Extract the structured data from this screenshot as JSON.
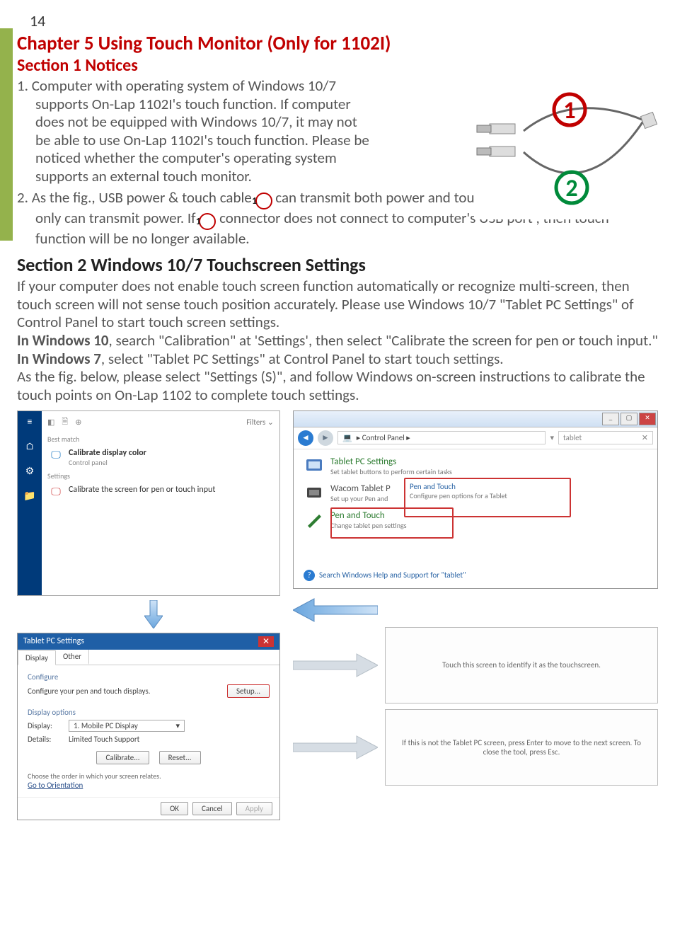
{
  "page_number": "14",
  "chapter_title": "Chapter 5  Using Touch Monitor (Only for 1102I)",
  "section1_title": "Section 1  Notices",
  "notice1_prefix": "1. Computer with operating system of Windows 10/7 supports On-Lap 1102I's touch function. If computer does not be equipped with Windows 10/7, it may not be able to use On-Lap 1102I's touch function. Please be noticed whether the computer's operating system supports an external touch monitor.",
  "notice2_a": "2. As the fig., USB power & touch cable ",
  "notice2_b": " can transmit both power and touch signal at the same time; ",
  "notice2_c": " only can transmit power. If  ",
  "notice2_d": " connector does not connect to computer's USB port , then touch function will be no longer available.",
  "circle_1": "1",
  "circle_2": "2",
  "section2_title": "Section 2 Windows 10/7 Touchscreen Settings",
  "section2_para1": "If your computer does not enable touch screen function automatically or recognize multi-screen, then touch screen will not sense touch position accurately. Please use Windows 10/7  \"Tablet PC Settings\" of Control Panel to start touch screen settings.",
  "section2_para2_a": "In Windows 10",
  "section2_para2_b": ", search \"Calibration\" at  'Settings', then select \"Calibrate the screen for pen or touch input.\"  ",
  "section2_para2_c": "In Windows 7",
  "section2_para2_d": ", select \"Tablet PC Settings\" at Control Panel to start touch settings.",
  "section2_para3": "As the fig. below, please select \"Settings (S)\", and follow  Windows on-screen instructions to calibrate the touch points on On-Lap 1102 to complete touch settings.",
  "win_search": {
    "filters": "Filters ⌄",
    "best_match_label": "Best match",
    "item1_title": "Calibrate display color",
    "item1_sub": "Control panel",
    "settings_label": "Settings",
    "item2_title": "Calibrate the screen for pen or touch input"
  },
  "tablet_dialog": {
    "title": "Tablet PC Settings",
    "tab_display": "Display",
    "tab_other": "Other",
    "group_configure": "Configure",
    "configure_text": "Configure your pen and touch displays.",
    "setup_btn": "Setup...",
    "group_display": "Display options",
    "display_label": "Display:",
    "display_value": "1. Mobile PC Display",
    "details_label": "Details:",
    "details_value": "Limited Touch Support",
    "calibrate_btn": "Calibrate...",
    "reset_btn": "Reset...",
    "order_text": "Choose the order in which your screen relates.",
    "orientation_link": "Go to Orientation",
    "ok": "OK",
    "cancel": "Cancel",
    "apply": "Apply"
  },
  "control_panel": {
    "breadcrumb": "▸ Control Panel ▸",
    "search_value": "tablet",
    "item1_title": "Tablet PC Settings",
    "item1_sub": "Set tablet buttons to perform certain tasks",
    "item2_title": "Wacom Tablet P",
    "item2_sub1": "Pen and Touch",
    "item2_sub2": "Configure pen options for a Tablet",
    "item2_sub3": "Set up your Pen and",
    "item3_title": "Pen and Touch",
    "item3_sub": "Change tablet pen settings",
    "footer": "Search Windows Help and Support for \"tablet\""
  },
  "calib1_text": "Touch this screen to identify it as the touchscreen.",
  "calib2_text": "If this is not the Tablet PC screen, press Enter to move to the next screen. To close the tool, press Esc."
}
